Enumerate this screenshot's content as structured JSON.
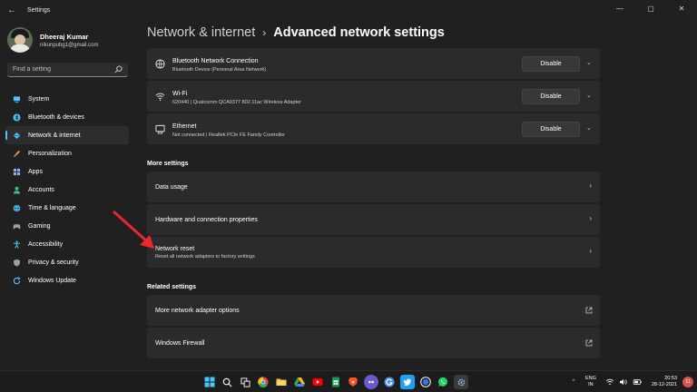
{
  "window": {
    "title": "Settings",
    "back_glyph": "←",
    "controls": {
      "minimize": "—",
      "maximize": "▢",
      "close": "✕"
    }
  },
  "profile": {
    "name": "Dheeraj Kumar",
    "email": "nikunpubg1@gmail.com"
  },
  "search": {
    "placeholder": "Find a setting",
    "icon": "search-icon"
  },
  "nav": [
    {
      "label": "System",
      "icon": "monitor-icon",
      "color": "#4cc2ff"
    },
    {
      "label": "Bluetooth & devices",
      "icon": "bluetooth-icon",
      "color": "#4cc2ff"
    },
    {
      "label": "Network & internet",
      "icon": "wifi-diamond-icon",
      "color": "#4cc2ff",
      "active": true
    },
    {
      "label": "Personalization",
      "icon": "brush-icon",
      "color": "#e3a04a"
    },
    {
      "label": "Apps",
      "icon": "apps-icon",
      "color": "#8fb0e8"
    },
    {
      "label": "Accounts",
      "icon": "person-icon",
      "color": "#3dbf8a"
    },
    {
      "label": "Time & language",
      "icon": "globe-icon",
      "color": "#4cc2ff"
    },
    {
      "label": "Gaming",
      "icon": "gamepad-icon",
      "color": "#9aa0a6"
    },
    {
      "label": "Accessibility",
      "icon": "accessibility-icon",
      "color": "#4cc2ff"
    },
    {
      "label": "Privacy & security",
      "icon": "shield-icon",
      "color": "#9aa0a6"
    },
    {
      "label": "Windows Update",
      "icon": "update-icon",
      "color": "#4cc2ff"
    }
  ],
  "breadcrumb": {
    "parent": "Network & internet",
    "separator": "›",
    "current": "Advanced network settings"
  },
  "adapters": [
    {
      "title": "Bluetooth Network Connection",
      "subtitle": "Bluetooth Device (Personal Area Network)",
      "icon": "bluetooth-network-icon",
      "button": "Disable"
    },
    {
      "title": "Wi-Fi",
      "subtitle": "620440 | Qualcomm QCA9377 802.11ac Wireless Adapter",
      "icon": "wifi-icon",
      "button": "Disable"
    },
    {
      "title": "Ethernet",
      "subtitle": "Not connected | Realtek PCIe FE Family Controller",
      "icon": "ethernet-icon",
      "button": "Disable"
    }
  ],
  "more_settings": {
    "label": "More settings",
    "items": [
      {
        "title": "Data usage"
      },
      {
        "title": "Hardware and connection properties"
      },
      {
        "title": "Network reset",
        "subtitle": "Reset all network adapters to factory settings"
      }
    ]
  },
  "related_settings": {
    "label": "Related settings",
    "items": [
      {
        "title": "More network adapter options"
      },
      {
        "title": "Windows Firewall"
      }
    ]
  },
  "glyphs": {
    "chevron_right": "›",
    "chevron_down": "⌄",
    "chevron_up": "⌃"
  },
  "taskbar": {
    "apps": [
      {
        "name": "windows-start-icon",
        "color": "#4cc2ff"
      },
      {
        "name": "search-icon",
        "color": "#ffffff"
      },
      {
        "name": "task-view-icon",
        "color": "#ffffff"
      },
      {
        "name": "chrome-icon",
        "color": "#e8453c"
      },
      {
        "name": "file-explorer-icon",
        "color": "#f4c542"
      },
      {
        "name": "google-drive-icon",
        "color": "#34a853"
      },
      {
        "name": "youtube-icon",
        "color": "#ff0000"
      },
      {
        "name": "sheets-icon",
        "color": "#0f9d58"
      },
      {
        "name": "brave-icon",
        "color": "#fb542b"
      },
      {
        "name": "bob-icon",
        "color": "#6a5acd"
      },
      {
        "name": "grammarly-icon",
        "color": "#4a90e2"
      },
      {
        "name": "twitter-icon",
        "color": "#1da1f2"
      },
      {
        "name": "signal-icon",
        "color": "#3a76f0"
      },
      {
        "name": "whatsapp-icon",
        "color": "#25d366"
      },
      {
        "name": "settings-icon",
        "color": "#7a9cc6"
      }
    ],
    "language": {
      "line1": "ENG",
      "line2": "IN"
    },
    "clock": {
      "time": "20:53",
      "date": "28-12-2021"
    },
    "notification_count": "11"
  },
  "colors": {
    "accent": "#4cc2ff",
    "annotation": "#e8282b"
  }
}
